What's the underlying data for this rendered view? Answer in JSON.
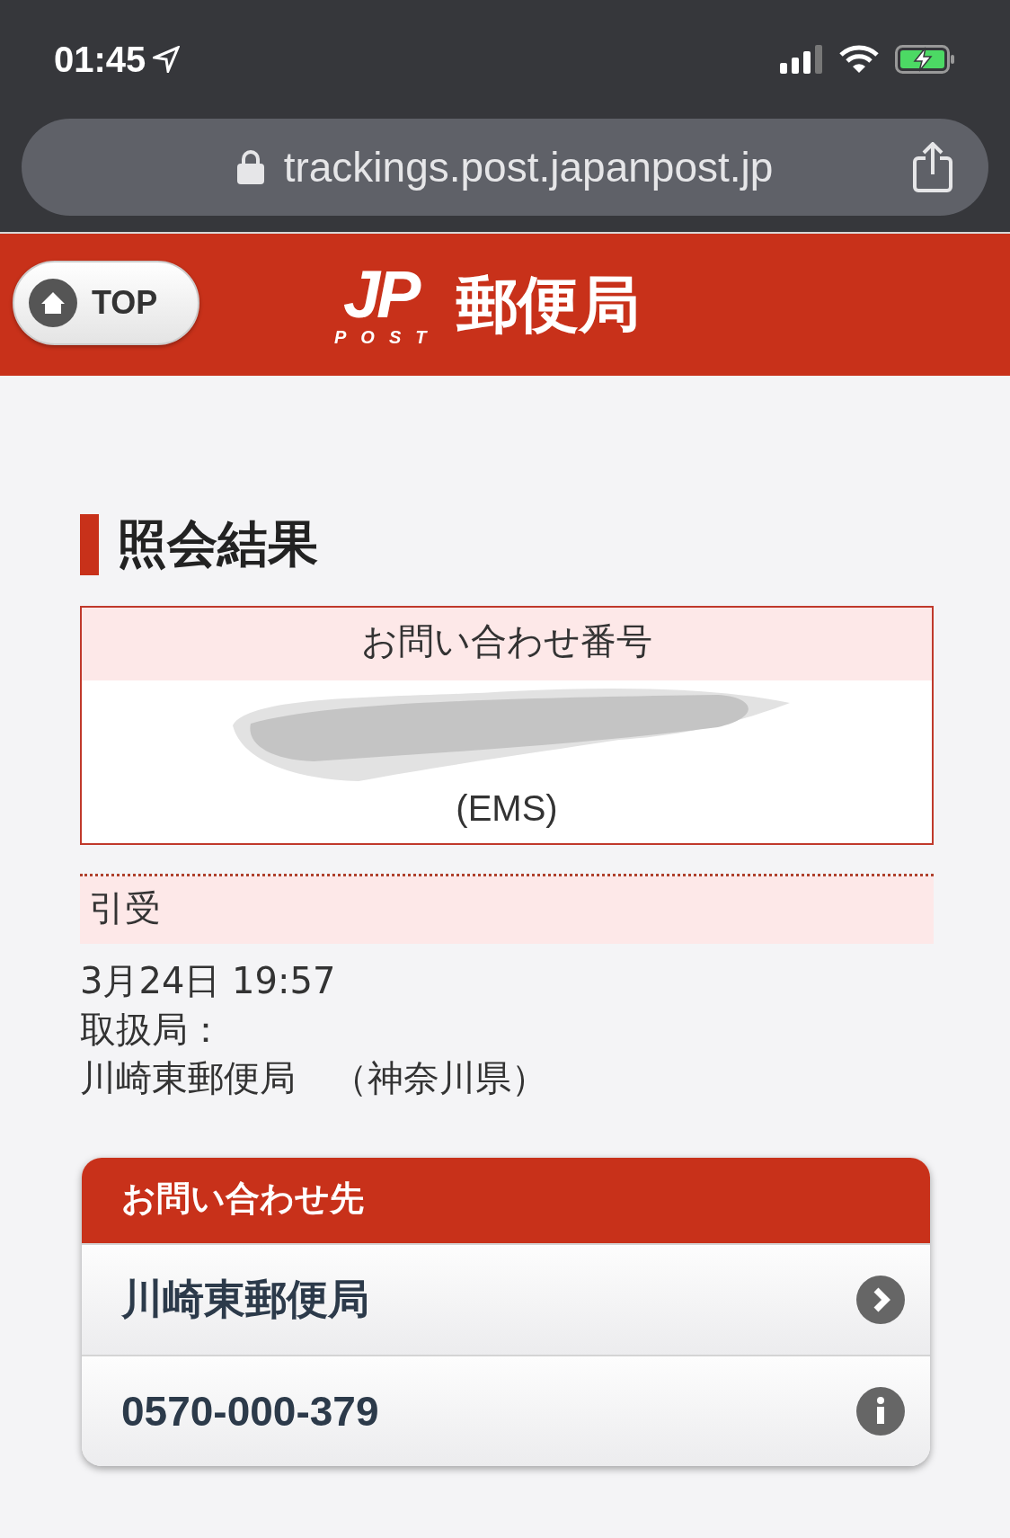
{
  "status_bar": {
    "time": "01:45"
  },
  "browser": {
    "url": "trackings.post.japanpost.jp"
  },
  "header": {
    "top_button": "TOP",
    "logo_mark": "JP",
    "logo_sub": "POST",
    "logo_name": "郵便局"
  },
  "title": "照会結果",
  "inquiry": {
    "label": "お問い合わせ番号",
    "service": "(EMS)"
  },
  "events": [
    {
      "status": "引受",
      "lines": [
        "3月24日 19:57",
        "取扱局：",
        "川崎東郵便局　（神奈川県）"
      ]
    }
  ],
  "contact": {
    "title": "お問い合わせ先",
    "items": [
      {
        "kind": "link",
        "label": "川崎東郵便局"
      },
      {
        "kind": "info",
        "label": "0570-000-379"
      }
    ]
  }
}
